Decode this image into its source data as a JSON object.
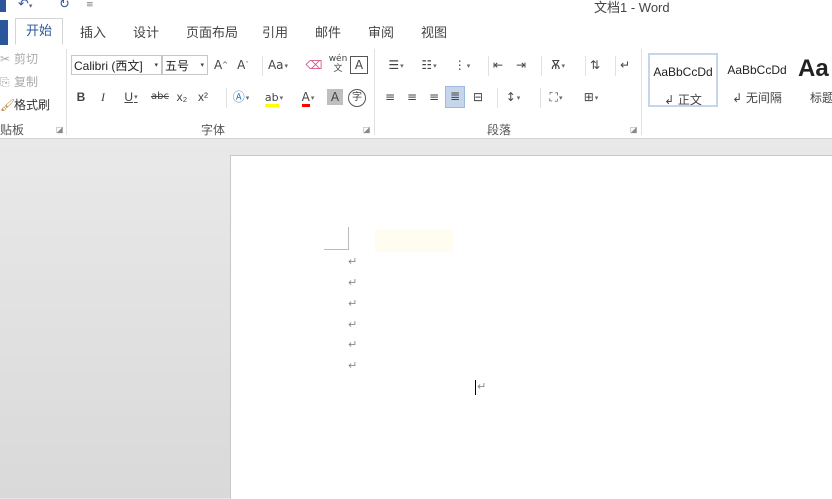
{
  "window": {
    "title": "文档1 - Word"
  },
  "qat": {
    "undo_icon": "undo-icon",
    "redo_icon": "redo-icon",
    "customize_icon": "qat-dropdown-icon"
  },
  "tabs": [
    "开始",
    "插入",
    "设计",
    "页面布局",
    "引用",
    "邮件",
    "审阅",
    "视图"
  ],
  "clipboard": {
    "cut": "剪切",
    "copy": "复制",
    "format_painter": "格式刷",
    "group": "贴板"
  },
  "font": {
    "name": "Calibri (西文正文)",
    "name_display": "Calibri (西文]",
    "size": "五号",
    "group": "字体",
    "change_case": "Aa",
    "strikethrough": "abc",
    "subscript": "x₂",
    "superscript": "x²",
    "phonetic": "wén",
    "enclose": "字"
  },
  "paragraph": {
    "group": "段落"
  },
  "styles": [
    {
      "preview": "AaBbCcDd",
      "name": "↲ 正文",
      "selected": true
    },
    {
      "preview": "AaBbCcDd",
      "name": "↲ 无间隔",
      "selected": false
    },
    {
      "preview": "Aa",
      "name": "标题",
      "selected": false
    }
  ],
  "document": {
    "paragraph_mark": "↵",
    "empty_paragraph_count": 6
  },
  "colors": {
    "accent": "#2b579a",
    "highlight": "#ffff00",
    "font_color": "#ff0000"
  }
}
